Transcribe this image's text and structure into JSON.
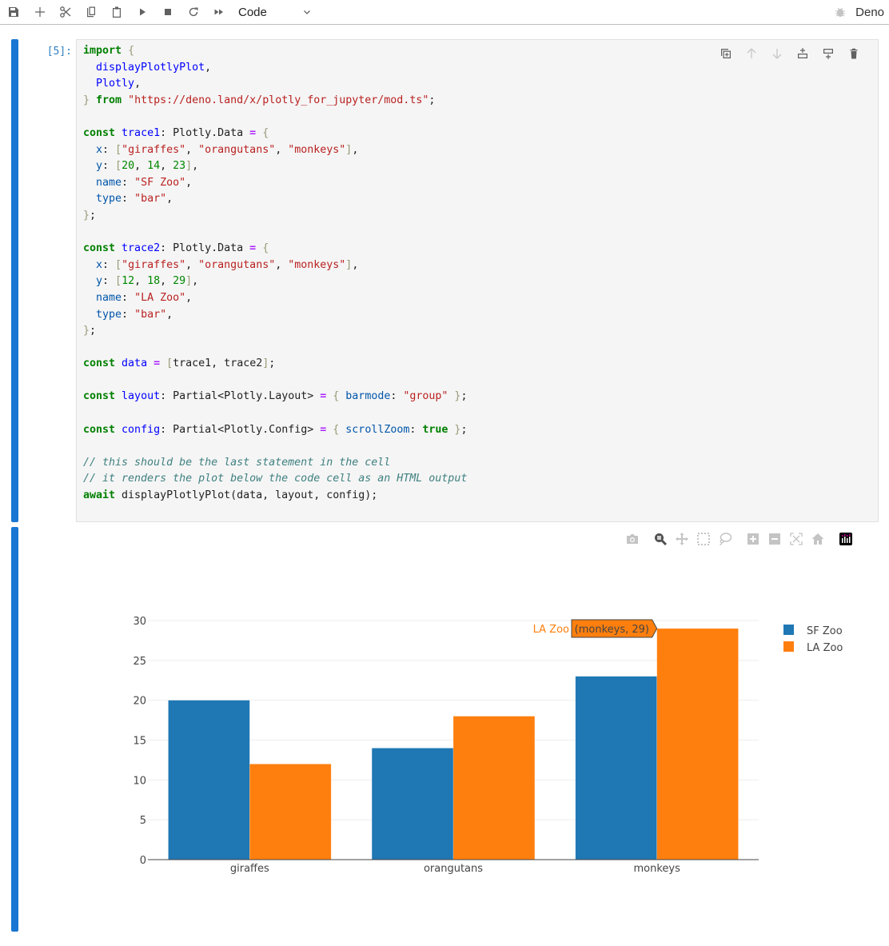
{
  "toolbar": {
    "buttons": [
      {
        "name": "save",
        "icon": "save-icon"
      },
      {
        "name": "insert-cell",
        "icon": "plus-icon"
      },
      {
        "name": "cut",
        "icon": "scissors-icon"
      },
      {
        "name": "copy",
        "icon": "copy-icon"
      },
      {
        "name": "paste",
        "icon": "paste-icon"
      },
      {
        "name": "run",
        "icon": "play-icon"
      },
      {
        "name": "interrupt",
        "icon": "stop-icon"
      },
      {
        "name": "restart",
        "icon": "refresh-icon"
      },
      {
        "name": "run-all",
        "icon": "fast-forward-icon"
      }
    ],
    "cell_type": "Code",
    "kernel_name": "Deno"
  },
  "cell": {
    "prompt": "[5]:",
    "tools": [
      "duplicate-icon",
      "move-up-icon",
      "move-down-icon",
      "insert-above-icon",
      "insert-below-icon",
      "delete-icon"
    ],
    "code_lines": [
      [
        [
          "kw",
          "import"
        ],
        [
          "tx",
          " "
        ],
        [
          "br",
          "{"
        ]
      ],
      [
        [
          "tx",
          "  "
        ],
        [
          "vd",
          "displayPlotlyPlot"
        ],
        [
          "tx",
          ","
        ]
      ],
      [
        [
          "tx",
          "  "
        ],
        [
          "vd",
          "Plotly"
        ],
        [
          "tx",
          ","
        ]
      ],
      [
        [
          "br",
          "}"
        ],
        [
          "tx",
          " "
        ],
        [
          "kw",
          "from"
        ],
        [
          "tx",
          " "
        ],
        [
          "st",
          "\"https://deno.land/x/plotly_for_jupyter/mod.ts\""
        ],
        [
          "tx",
          ";"
        ]
      ],
      [],
      [
        [
          "kw",
          "const"
        ],
        [
          "tx",
          " "
        ],
        [
          "vd",
          "trace1"
        ],
        [
          "tx",
          ": Plotly.Data "
        ],
        [
          "op",
          "="
        ],
        [
          "tx",
          " "
        ],
        [
          "br",
          "{"
        ]
      ],
      [
        [
          "tx",
          "  "
        ],
        [
          "pr",
          "x"
        ],
        [
          "tx",
          ": "
        ],
        [
          "br",
          "["
        ],
        [
          "st",
          "\"giraffes\""
        ],
        [
          "tx",
          ", "
        ],
        [
          "st",
          "\"orangutans\""
        ],
        [
          "tx",
          ", "
        ],
        [
          "st",
          "\"monkeys\""
        ],
        [
          "br",
          "]"
        ],
        [
          "tx",
          ","
        ]
      ],
      [
        [
          "tx",
          "  "
        ],
        [
          "pr",
          "y"
        ],
        [
          "tx",
          ": "
        ],
        [
          "br",
          "["
        ],
        [
          "nm",
          "20"
        ],
        [
          "tx",
          ", "
        ],
        [
          "nm",
          "14"
        ],
        [
          "tx",
          ", "
        ],
        [
          "nm",
          "23"
        ],
        [
          "br",
          "]"
        ],
        [
          "tx",
          ","
        ]
      ],
      [
        [
          "tx",
          "  "
        ],
        [
          "pr",
          "name"
        ],
        [
          "tx",
          ": "
        ],
        [
          "st",
          "\"SF Zoo\""
        ],
        [
          "tx",
          ","
        ]
      ],
      [
        [
          "tx",
          "  "
        ],
        [
          "pr",
          "type"
        ],
        [
          "tx",
          ": "
        ],
        [
          "st",
          "\"bar\""
        ],
        [
          "tx",
          ","
        ]
      ],
      [
        [
          "br",
          "}"
        ],
        [
          "tx",
          ";"
        ]
      ],
      [],
      [
        [
          "kw",
          "const"
        ],
        [
          "tx",
          " "
        ],
        [
          "vd",
          "trace2"
        ],
        [
          "tx",
          ": Plotly.Data "
        ],
        [
          "op",
          "="
        ],
        [
          "tx",
          " "
        ],
        [
          "br",
          "{"
        ]
      ],
      [
        [
          "tx",
          "  "
        ],
        [
          "pr",
          "x"
        ],
        [
          "tx",
          ": "
        ],
        [
          "br",
          "["
        ],
        [
          "st",
          "\"giraffes\""
        ],
        [
          "tx",
          ", "
        ],
        [
          "st",
          "\"orangutans\""
        ],
        [
          "tx",
          ", "
        ],
        [
          "st",
          "\"monkeys\""
        ],
        [
          "br",
          "]"
        ],
        [
          "tx",
          ","
        ]
      ],
      [
        [
          "tx",
          "  "
        ],
        [
          "pr",
          "y"
        ],
        [
          "tx",
          ": "
        ],
        [
          "br",
          "["
        ],
        [
          "nm",
          "12"
        ],
        [
          "tx",
          ", "
        ],
        [
          "nm",
          "18"
        ],
        [
          "tx",
          ", "
        ],
        [
          "nm",
          "29"
        ],
        [
          "br",
          "]"
        ],
        [
          "tx",
          ","
        ]
      ],
      [
        [
          "tx",
          "  "
        ],
        [
          "pr",
          "name"
        ],
        [
          "tx",
          ": "
        ],
        [
          "st",
          "\"LA Zoo\""
        ],
        [
          "tx",
          ","
        ]
      ],
      [
        [
          "tx",
          "  "
        ],
        [
          "pr",
          "type"
        ],
        [
          "tx",
          ": "
        ],
        [
          "st",
          "\"bar\""
        ],
        [
          "tx",
          ","
        ]
      ],
      [
        [
          "br",
          "}"
        ],
        [
          "tx",
          ";"
        ]
      ],
      [],
      [
        [
          "kw",
          "const"
        ],
        [
          "tx",
          " "
        ],
        [
          "vd",
          "data"
        ],
        [
          "tx",
          " "
        ],
        [
          "op",
          "="
        ],
        [
          "tx",
          " "
        ],
        [
          "br",
          "["
        ],
        [
          "tx",
          "trace1, trace2"
        ],
        [
          "br",
          "]"
        ],
        [
          "tx",
          ";"
        ]
      ],
      [],
      [
        [
          "kw",
          "const"
        ],
        [
          "tx",
          " "
        ],
        [
          "vd",
          "layout"
        ],
        [
          "tx",
          ": Partial<Plotly.Layout> "
        ],
        [
          "op",
          "="
        ],
        [
          "tx",
          " "
        ],
        [
          "br",
          "{"
        ],
        [
          "tx",
          " "
        ],
        [
          "pr",
          "barmode"
        ],
        [
          "tx",
          ": "
        ],
        [
          "st",
          "\"group\""
        ],
        [
          "tx",
          " "
        ],
        [
          "br",
          "}"
        ],
        [
          "tx",
          ";"
        ]
      ],
      [],
      [
        [
          "kw",
          "const"
        ],
        [
          "tx",
          " "
        ],
        [
          "vd",
          "config"
        ],
        [
          "tx",
          ": Partial<Plotly.Config> "
        ],
        [
          "op",
          "="
        ],
        [
          "tx",
          " "
        ],
        [
          "br",
          "{"
        ],
        [
          "tx",
          " "
        ],
        [
          "pr",
          "scrollZoom"
        ],
        [
          "tx",
          ": "
        ],
        [
          "kw",
          "true"
        ],
        [
          "tx",
          " "
        ],
        [
          "br",
          "}"
        ],
        [
          "tx",
          ";"
        ]
      ],
      [],
      [
        [
          "cm",
          "// this should be the last statement in the cell"
        ]
      ],
      [
        [
          "cm",
          "// it renders the plot below the code cell as an HTML output"
        ]
      ],
      [
        [
          "kw",
          "await"
        ],
        [
          "tx",
          " displayPlotlyPlot(data, layout, config);"
        ]
      ]
    ]
  },
  "modebar": [
    "camera-icon",
    "zoom-icon",
    "pan-icon",
    "box-select-icon",
    "lasso-select-icon",
    "zoom-in-icon",
    "zoom-out-icon",
    "autoscale-icon",
    "reset-axes-icon",
    "plotly-logo-icon"
  ],
  "chart_data": {
    "type": "bar",
    "barmode": "group",
    "categories": [
      "giraffes",
      "orangutans",
      "monkeys"
    ],
    "series": [
      {
        "name": "SF Zoo",
        "values": [
          20,
          14,
          23
        ],
        "color": "#1f77b4"
      },
      {
        "name": "LA Zoo",
        "values": [
          12,
          18,
          29
        ],
        "color": "#ff7f0e"
      }
    ],
    "title": "",
    "xlabel": "",
    "ylabel": "",
    "ylim": [
      0,
      30.5
    ],
    "yticks": [
      0,
      5,
      10,
      15,
      20,
      25,
      30
    ],
    "grid": true,
    "legend": "top-right",
    "hover": {
      "series": "LA Zoo",
      "label": "(monkeys, 29)",
      "category": "monkeys"
    }
  }
}
